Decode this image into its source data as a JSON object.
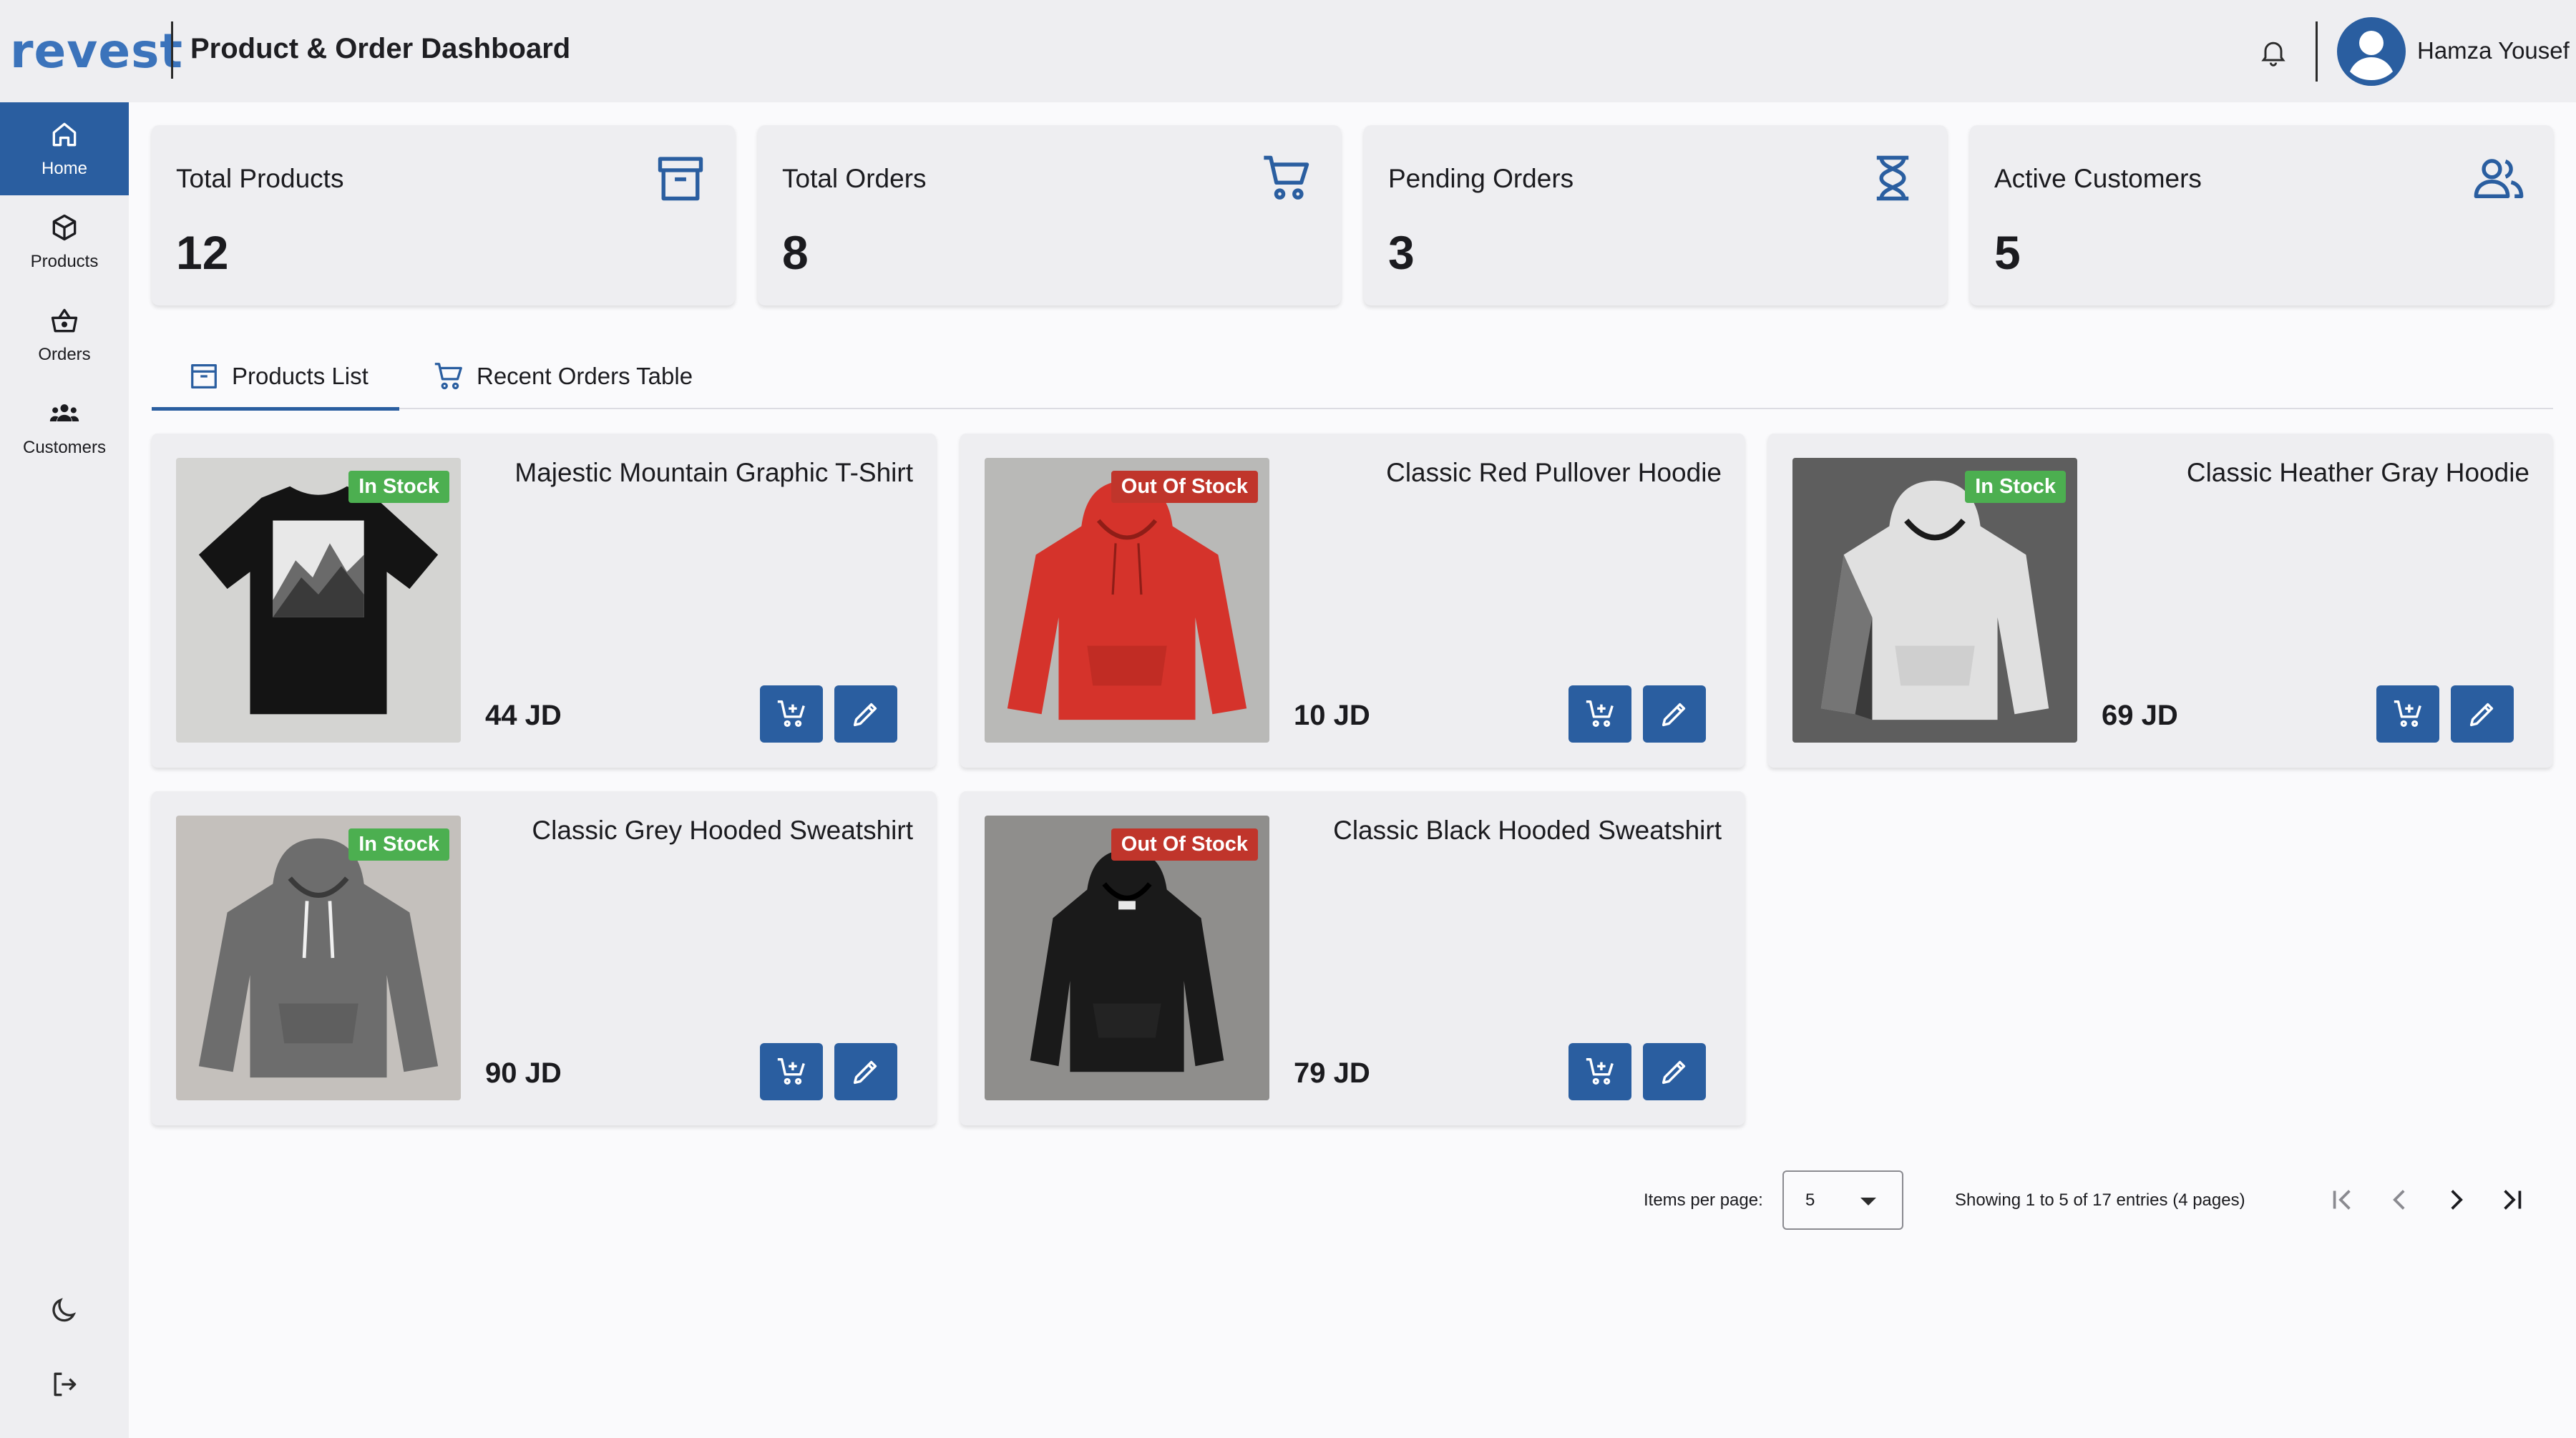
{
  "header": {
    "logo_text": "revest",
    "title": "Product & Order Dashboard",
    "user_name": "Hamza Yousef"
  },
  "sidebar": {
    "items": [
      {
        "label": "Home",
        "icon": "home-icon",
        "active": true
      },
      {
        "label": "Products",
        "icon": "cube-icon",
        "active": false
      },
      {
        "label": "Orders",
        "icon": "basket-icon",
        "active": false
      },
      {
        "label": "Customers",
        "icon": "people-icon",
        "active": false
      }
    ],
    "bottom_icons": [
      "moon-icon",
      "logout-icon"
    ]
  },
  "stats": [
    {
      "label": "Total Products",
      "value": "12",
      "icon": "archive-box-icon"
    },
    {
      "label": "Total Orders",
      "value": "8",
      "icon": "cart-icon"
    },
    {
      "label": "Pending Orders",
      "value": "3",
      "icon": "hourglass-icon"
    },
    {
      "label": "Active Customers",
      "value": "5",
      "icon": "users-icon"
    }
  ],
  "tabs": [
    {
      "label": "Products List",
      "icon": "archive-box-icon",
      "active": true
    },
    {
      "label": "Recent Orders Table",
      "icon": "cart-icon",
      "active": false
    }
  ],
  "products": [
    {
      "name": "Majestic Mountain Graphic T-Shirt",
      "price": "44 JD",
      "stock": "In Stock"
    },
    {
      "name": "Classic Red Pullover Hoodie",
      "price": "10 JD",
      "stock": "Out Of Stock"
    },
    {
      "name": "Classic Heather Gray Hoodie",
      "price": "69 JD",
      "stock": "In Stock"
    },
    {
      "name": "Classic Grey Hooded Sweatshirt",
      "price": "90 JD",
      "stock": "In Stock"
    },
    {
      "name": "Classic Black Hooded Sweatshirt",
      "price": "79 JD",
      "stock": "Out Of Stock"
    }
  ],
  "pagination": {
    "items_per_page_label": "Items per page:",
    "items_per_page_value": "5",
    "info": "Showing 1 to 5 of 17 entries (4 pages)"
  },
  "colors": {
    "primary": "#2a5ea0",
    "in_stock": "#4caf50",
    "out_of_stock": "#c0352b",
    "panel": "#eeeef1"
  }
}
